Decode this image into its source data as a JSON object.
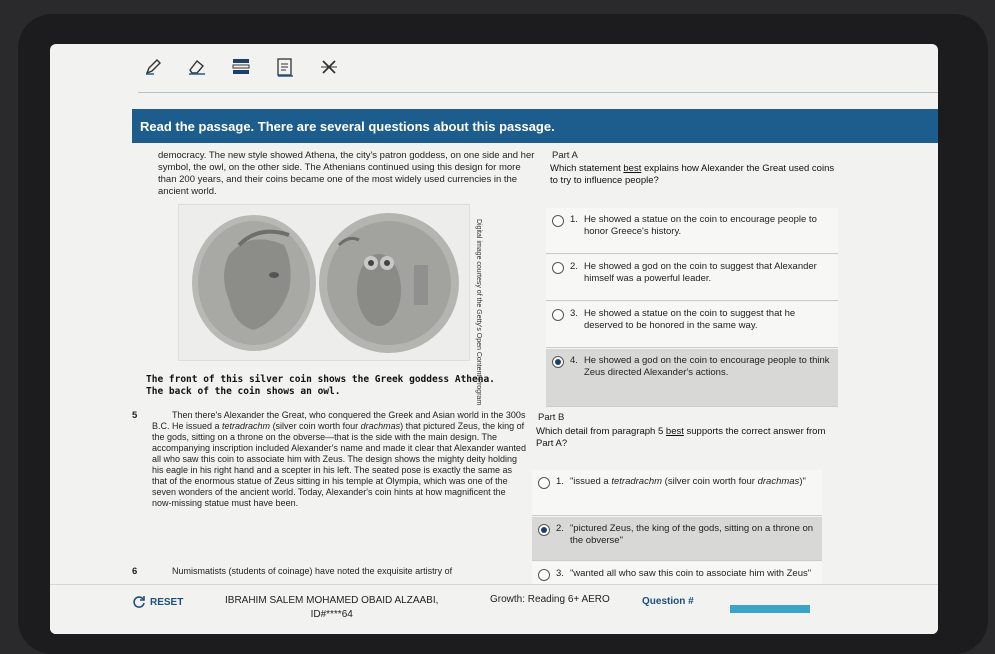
{
  "toolbar": {
    "tools": [
      {
        "icon": "pencil-icon"
      },
      {
        "icon": "eraser-icon"
      },
      {
        "icon": "line-reader-icon"
      },
      {
        "icon": "notepad-icon"
      },
      {
        "icon": "answer-eliminator-icon"
      }
    ]
  },
  "banner": {
    "text": "Read the passage. There are several questions about this passage."
  },
  "passage": {
    "top_text": "democracy. The new style showed Athena, the city's patron goddess, on one side and her symbol, the owl, on the other side. The Athenians continued using this design for more than 200 years, and their coins became one of the most widely used currencies in the ancient world.",
    "image_credit": "Digital image courtesy of the Getty's Open Content Program",
    "caption_line1": "The front of this silver coin shows the Greek goddess Athena.",
    "caption_line2": "The back of the coin shows an owl.",
    "para5_num": "5",
    "para5_text_a": "Then there's Alexander the Great, who conquered the Greek and Asian world in the 300s B.C. He issued a ",
    "para5_text_italic1": "tetradrachm",
    "para5_text_b": " (silver coin worth four ",
    "para5_text_italic2": "drachmas",
    "para5_text_c": ") that pictured Zeus, the king of the gods, sitting on a throne on the obverse—that is the side with the main design. The accompanying inscription included Alexander's name and made it clear that Alexander wanted all who saw this coin to associate him with Zeus. The design shows the mighty deity holding his eagle in his right hand and a scepter in his left. The seated pose is exactly the same as that of the enormous statue of Zeus sitting in his temple at Olympia, which was one of the seven wonders of the ancient world. Today, Alexander's coin hints at how magnificent the now-missing statue must have been.",
    "para6_num": "6",
    "para6_text": "Numismatists (students of coinage) have noted the exquisite artistry of"
  },
  "part_a": {
    "label": "Part A",
    "question_pre": "Which statement ",
    "question_underlined": "best",
    "question_post": " explains how Alexander the Great used coins to try to influence people?",
    "options": [
      {
        "num": "1.",
        "text": "He showed a statue on the coin to encourage people to honor Greece's history.",
        "selected": false
      },
      {
        "num": "2.",
        "text": "He showed a god on the coin to suggest that Alexander himself was a powerful leader.",
        "selected": false
      },
      {
        "num": "3.",
        "text": "He showed a statue on the coin to suggest that he deserved to be honored in the same way.",
        "selected": false
      },
      {
        "num": "4.",
        "text": "He showed a god on the coin to encourage people to think Zeus directed Alexander's actions.",
        "selected": true
      }
    ]
  },
  "part_b": {
    "label": "Part B",
    "question_pre": "Which detail from paragraph 5 ",
    "question_underlined": "best",
    "question_post": " supports the correct answer from Part A?",
    "options": [
      {
        "num": "1.",
        "text_a": "\"issued a ",
        "text_italic1": "tetradrachm",
        "text_b": " (silver coin worth four ",
        "text_italic2": "drachmas",
        "text_c": ")\"",
        "selected": false
      },
      {
        "num": "2.",
        "text": "\"pictured Zeus, the king of the gods, sitting on a throne on the obverse\"",
        "selected": true
      },
      {
        "num": "3.",
        "text": "\"wanted all who saw this coin to associate him with Zeus\"",
        "selected": false
      }
    ]
  },
  "footer": {
    "reset_label": "RESET",
    "student_name": "IBRAHIM SALEM MOHAMED OBAID ALZAABI,",
    "student_id": "ID#****64",
    "growth": "Growth: Reading 6+ AERO",
    "question_label": "Question #"
  }
}
